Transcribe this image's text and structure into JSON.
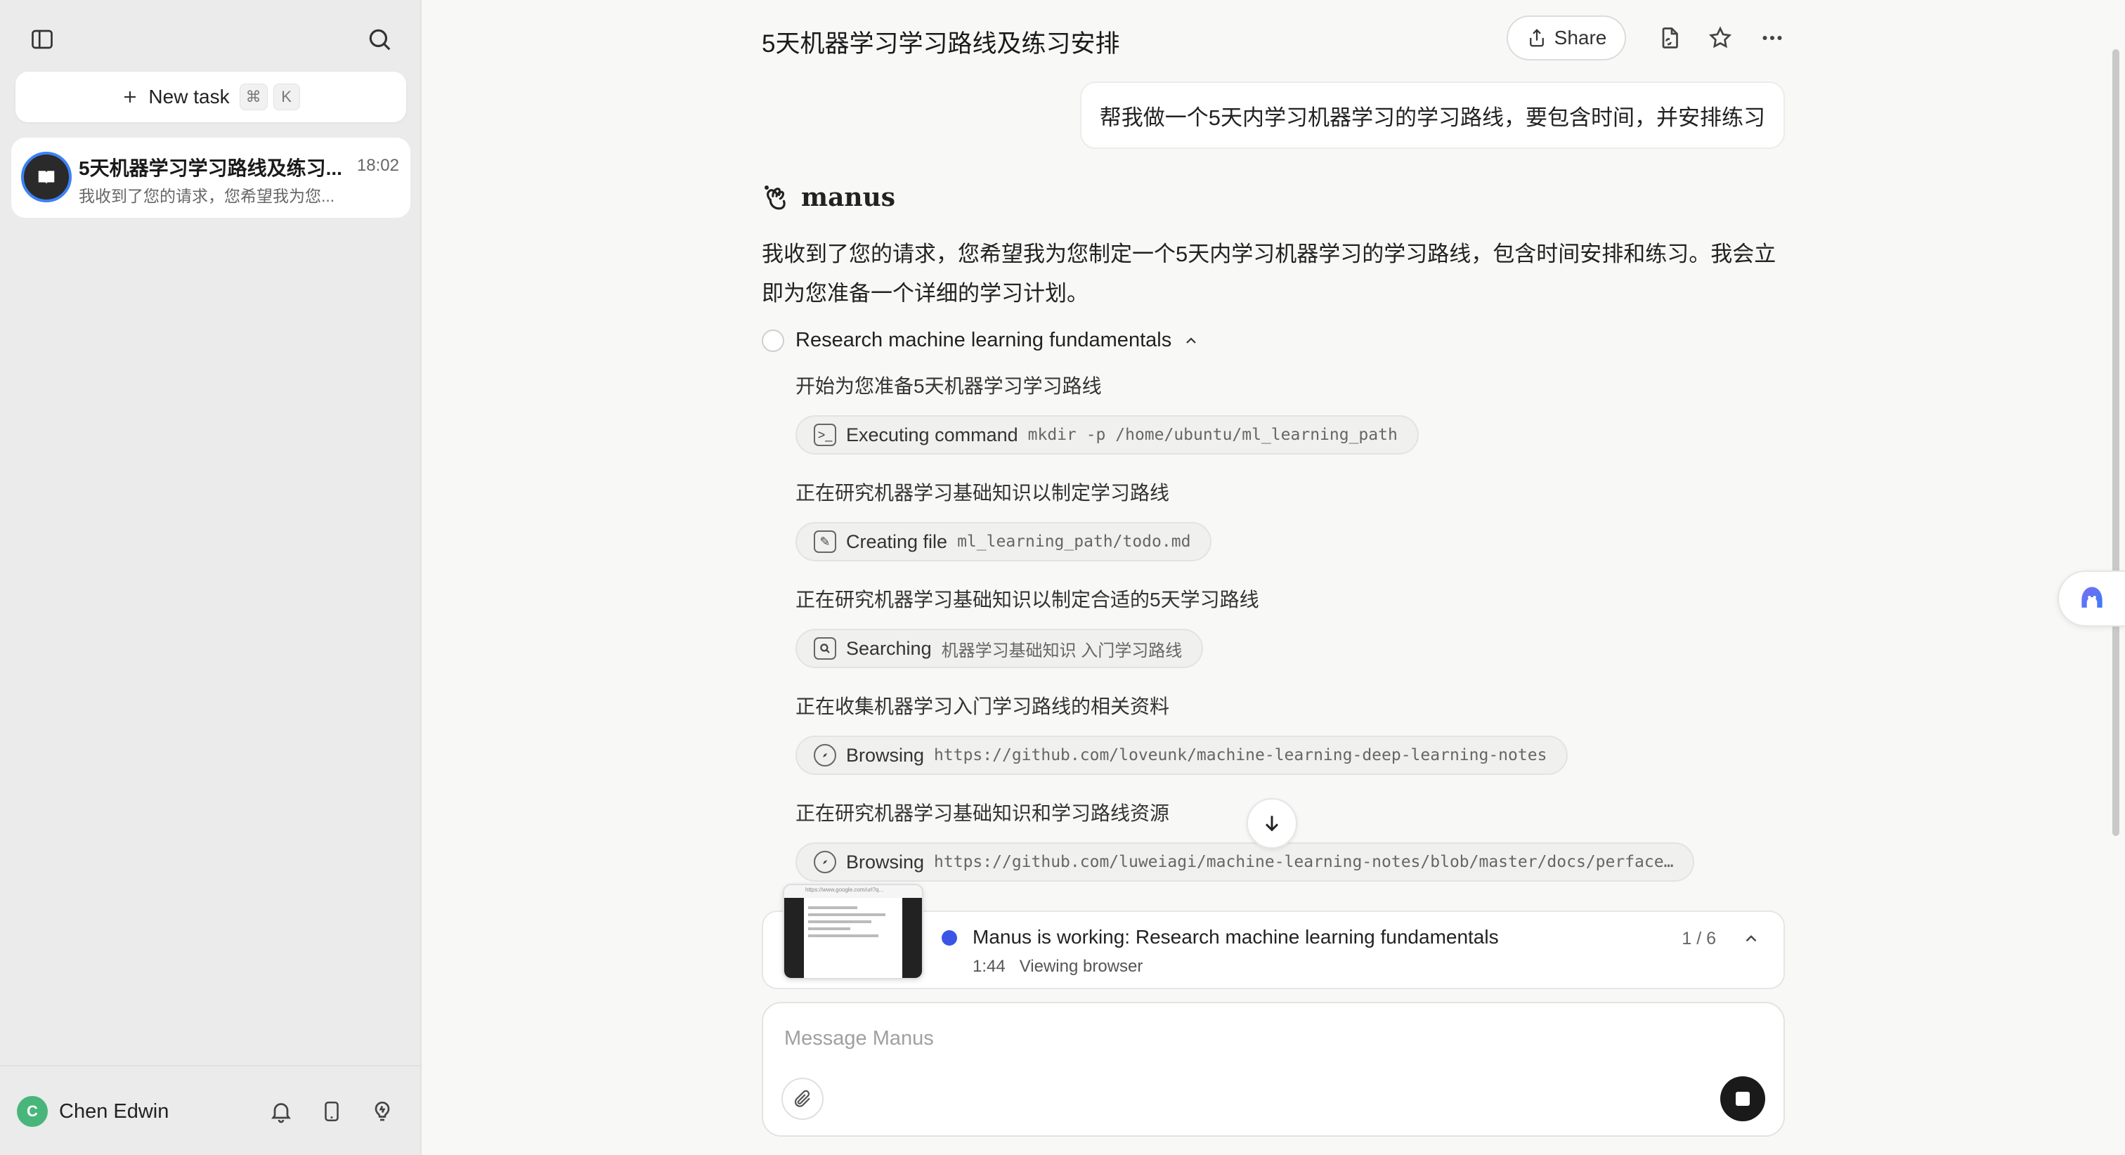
{
  "sidebar": {
    "new_task_label": "New task",
    "new_task_shortcut_mod": "⌘",
    "new_task_shortcut_key": "K",
    "tasks": [
      {
        "title": "5天机器学习学习路线及练习...",
        "time": "18:02",
        "preview": "我收到了您的请求，您希望我为您..."
      }
    ],
    "user": {
      "initial": "C",
      "name": "Chen Edwin"
    }
  },
  "header": {
    "title": "5天机器学习学习路线及练习安排",
    "share_label": "Share"
  },
  "conversation": {
    "user_message": "帮我做一个5天内学习机器学习的学习路线，要包含时间，并安排练习",
    "assistant_name": "manus",
    "assistant_reply": "我收到了您的请求，您希望我为您制定一个5天内学习机器学习的学习路线，包含时间安排和练习。我会立即为您准备一个详细的学习计划。",
    "step": {
      "title": "Research machine learning fundamentals",
      "entries": [
        {
          "text": "开始为您准备5天机器学习学习路线",
          "action": "Executing command",
          "arg": "mkdir -p /home/ubuntu/ml_learning_path",
          "icon": "terminal-icon"
        },
        {
          "text": "正在研究机器学习基础知识以制定学习路线",
          "action": "Creating file",
          "arg": "ml_learning_path/todo.md",
          "icon": "edit-file-icon"
        },
        {
          "text": "正在研究机器学习基础知识以制定合适的5天学习路线",
          "action": "Searching",
          "arg": "机器学习基础知识 入门学习路线",
          "icon": "search-icon"
        },
        {
          "text": "正在收集机器学习入门学习路线的相关资料",
          "action": "Browsing",
          "arg": "https://github.com/loveunk/machine-learning-deep-learning-notes",
          "icon": "compass-icon"
        },
        {
          "text": "正在研究机器学习基础知识和学习路线资源",
          "action": "Browsing",
          "arg": "https://github.com/luweiagi/machine-learning-notes/blob/master/docs/perface…",
          "icon": "compass-icon"
        }
      ]
    }
  },
  "status": {
    "thumbnail_url_text": "https://www.google.com/url?q...",
    "text": "Manus is working: Research machine learning fundamentals",
    "elapsed": "1:44",
    "activity": "Viewing browser",
    "progress": "1 / 6"
  },
  "composer": {
    "placeholder": "Message Manus"
  },
  "colors": {
    "accent": "#3a55e6",
    "user_avatar": "#48b67b"
  }
}
